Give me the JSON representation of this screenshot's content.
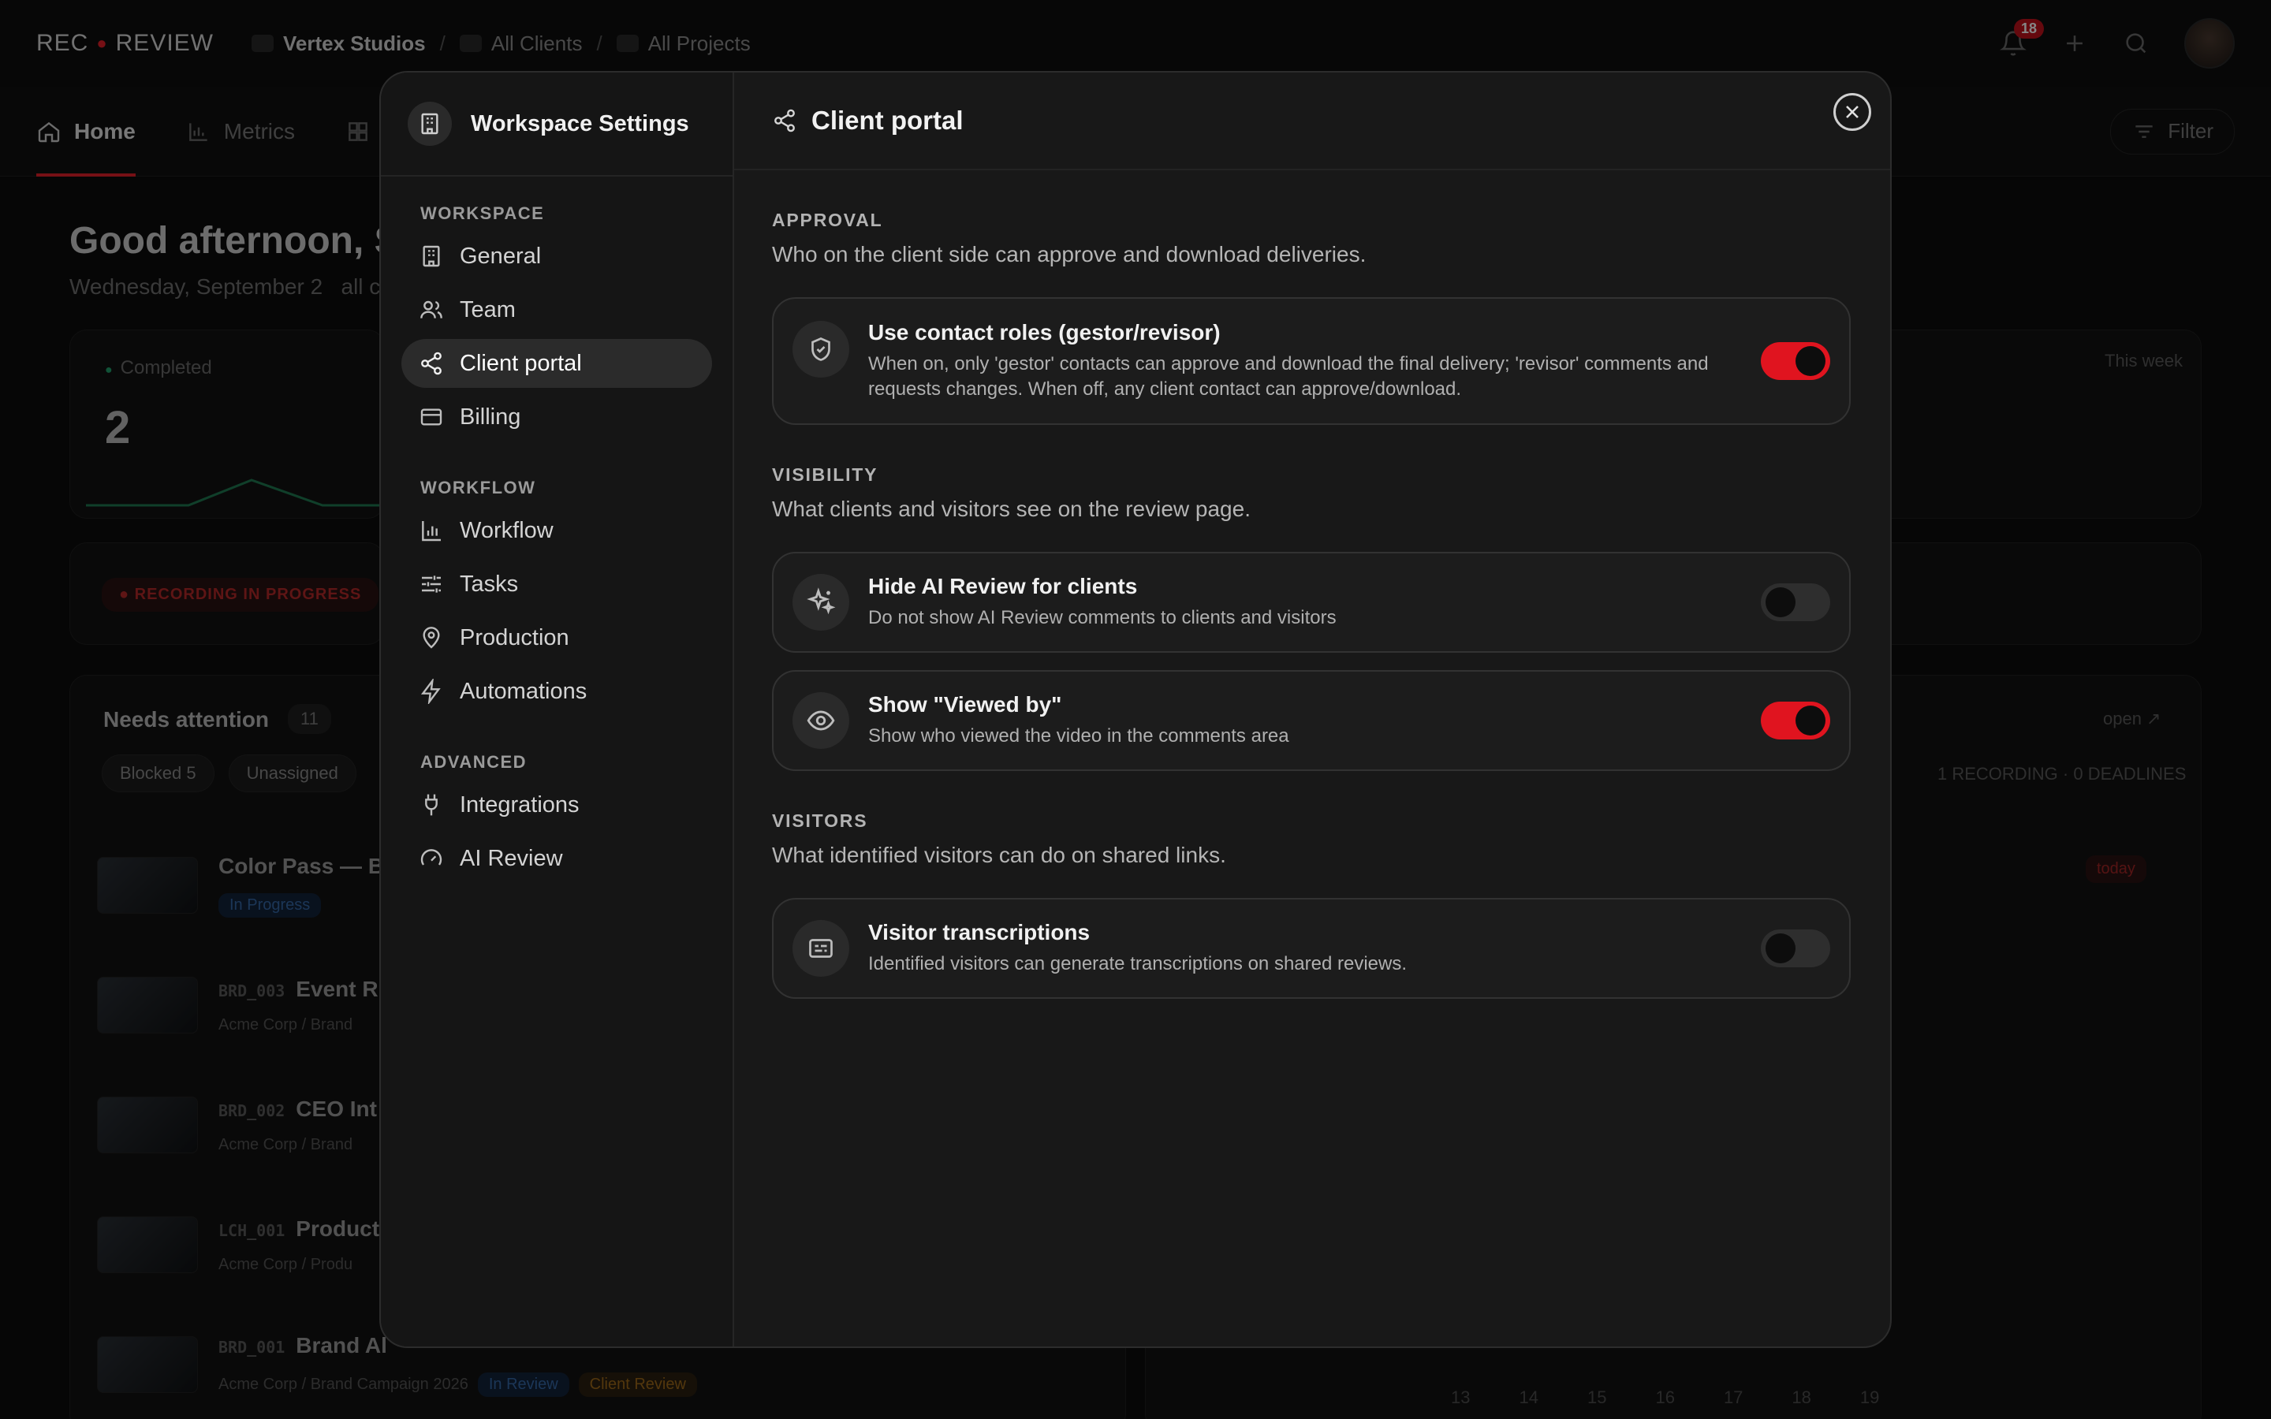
{
  "app": {
    "logo_left": "REC",
    "logo_right": "REVIEW",
    "breadcrumbs": [
      "Vertex Studios",
      "All Clients",
      "All Projects"
    ],
    "notifications_count": "18"
  },
  "nav": {
    "tabs": [
      "Home",
      "Metrics"
    ],
    "filter_label": "Filter"
  },
  "dashboard": {
    "greeting": "Good afternoon, Sa",
    "date": "Wednesday, September 2",
    "date_suffix": "all c",
    "completed_label": "Completed",
    "completed_value": "2",
    "this_week": "This week",
    "recording_chip": "RECORDING IN PROGRESS",
    "needs_attention": "Needs attention",
    "needs_count": "11",
    "chips": [
      "Blocked 5",
      "Unassigned"
    ],
    "open_link": "open ↗",
    "recordings_summary": "1 RECORDING · 0 DEADLINES",
    "today_label": "today",
    "rows": [
      {
        "code": "",
        "title": "Color Pass — Bra",
        "meta": "In Progress"
      },
      {
        "code": "BRD_003",
        "title": "Event R",
        "meta": "Acme Corp / Brand"
      },
      {
        "code": "BRD_002",
        "title": "CEO Int",
        "meta": "Acme Corp / Brand"
      },
      {
        "code": "LCH_001",
        "title": "Product",
        "meta": "Acme Corp / Produ"
      },
      {
        "code": "BRD_001",
        "title": "Brand Al",
        "meta": "Acme Corp / Brand Campaign 2026"
      }
    ],
    "row_last_status": "In Review",
    "row_last_review": "Client Review",
    "calendar_days": [
      "13",
      "14",
      "15",
      "16",
      "17",
      "18",
      "19"
    ]
  },
  "modal": {
    "sidebar_title": "Workspace Settings",
    "sections": [
      {
        "label": "WORKSPACE",
        "items": [
          {
            "label": "General",
            "icon": "building-icon"
          },
          {
            "label": "Team",
            "icon": "users-icon"
          },
          {
            "label": "Client portal",
            "icon": "share-icon",
            "active": true
          },
          {
            "label": "Billing",
            "icon": "card-icon"
          }
        ]
      },
      {
        "label": "WORKFLOW",
        "items": [
          {
            "label": "Workflow",
            "icon": "bar-chart-icon"
          },
          {
            "label": "Tasks",
            "icon": "sliders-icon"
          },
          {
            "label": "Production",
            "icon": "map-pin-icon"
          },
          {
            "label": "Automations",
            "icon": "bolt-icon"
          }
        ]
      },
      {
        "label": "ADVANCED",
        "items": [
          {
            "label": "Integrations",
            "icon": "plug-icon"
          },
          {
            "label": "AI Review",
            "icon": "gauge-icon"
          }
        ]
      }
    ],
    "title": "Client portal",
    "groups": [
      {
        "label": "APPROVAL",
        "desc": "Who on the client side can approve and download deliveries.",
        "settings": [
          {
            "title": "Use contact roles (gestor/revisor)",
            "desc": "When on, only 'gestor' contacts can approve and download the final delivery; 'revisor' comments and requests changes. When off, any client contact can approve/download.",
            "enabled": true,
            "icon": "shield-check-icon"
          }
        ]
      },
      {
        "label": "VISIBILITY",
        "desc": "What clients and visitors see on the review page.",
        "settings": [
          {
            "title": "Hide AI Review for clients",
            "desc": "Do not show AI Review comments to clients and visitors",
            "enabled": false,
            "icon": "sparkles-icon"
          },
          {
            "title": "Show \"Viewed by\"",
            "desc": "Show who viewed the video in the comments area",
            "enabled": true,
            "icon": "eye-icon"
          }
        ]
      },
      {
        "label": "VISITORS",
        "desc": "What identified visitors can do on shared links.",
        "settings": [
          {
            "title": "Visitor transcriptions",
            "desc": "Identified visitors can generate transcriptions on shared reviews.",
            "enabled": false,
            "icon": "captions-icon"
          }
        ]
      }
    ]
  },
  "colors": {
    "accent": "#e0141f",
    "toggle_off": "#2e2e2e",
    "modal_bg": "#181818"
  }
}
